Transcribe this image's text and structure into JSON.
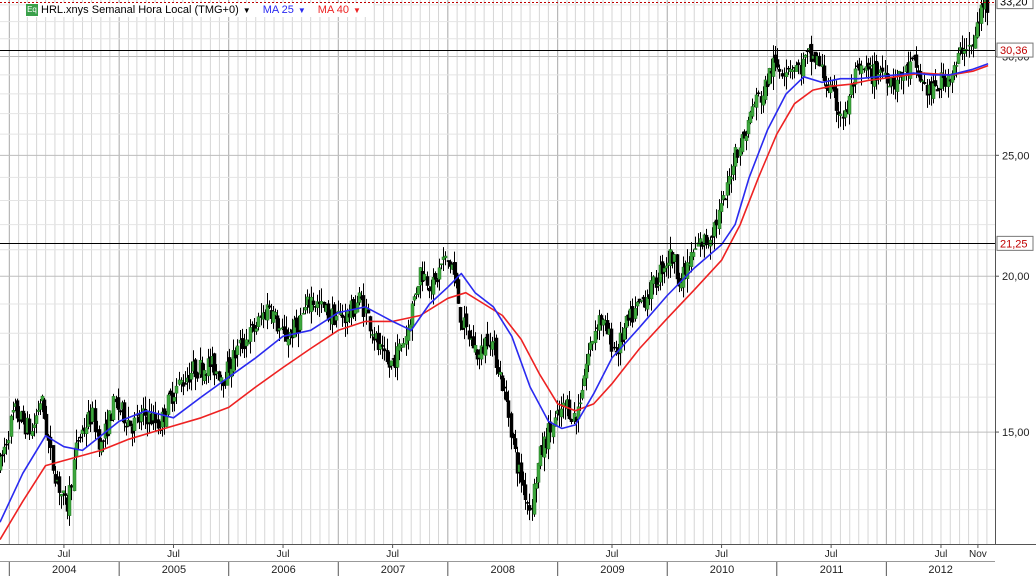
{
  "legend": {
    "icon": "Eq",
    "instrument": "HRL.xnys Semanal Hora Local (TMG+0)",
    "ma25": "MA 25",
    "ma40": "MA 40",
    "colors": {
      "ma25": "#2a2af0",
      "ma40": "#ee2222",
      "icon": "#3aa04a"
    }
  },
  "chart_data": {
    "type": "candlestick",
    "frequency": "weekly",
    "y_axis": {
      "ticks": [
        15.0,
        20.0,
        25.0,
        30.0
      ],
      "tick_labels": [
        "15,00",
        "20,00",
        "25,00",
        "30,00"
      ],
      "ylim": [
        12.2,
        33.3
      ],
      "position": "right"
    },
    "x_axis": {
      "xlim": [
        "2003-12-01",
        "2012-12-28"
      ],
      "years": [
        {
          "label": "2004",
          "date": "2004-01-01"
        },
        {
          "label": "2005",
          "date": "2005-01-01"
        },
        {
          "label": "2006",
          "date": "2006-01-01"
        },
        {
          "label": "2007",
          "date": "2007-01-01"
        },
        {
          "label": "2008",
          "date": "2008-01-01"
        },
        {
          "label": "2009",
          "date": "2009-01-01"
        },
        {
          "label": "2010",
          "date": "2010-01-01"
        },
        {
          "label": "2011",
          "date": "2011-01-01"
        },
        {
          "label": "2012",
          "date": "2012-01-01"
        }
      ],
      "months": [
        {
          "label": "Jul",
          "date": "2004-07-01"
        },
        {
          "label": "Jul",
          "date": "2005-07-01"
        },
        {
          "label": "Jul",
          "date": "2006-07-01"
        },
        {
          "label": "Jul",
          "date": "2007-07-01"
        },
        {
          "label": "Jul",
          "date": "2009-07-01"
        },
        {
          "label": "Jul",
          "date": "2010-07-01"
        },
        {
          "label": "Jul",
          "date": "2011-07-01"
        },
        {
          "label": "Jul",
          "date": "2012-07-01"
        },
        {
          "label": "Nov",
          "date": "2012-11-01"
        }
      ]
    },
    "price_path": [
      [
        "2003-12-01",
        14.1
      ],
      [
        "2004-01-15",
        15.6
      ],
      [
        "2004-03-15",
        15.0
      ],
      [
        "2004-04-15",
        16.0
      ],
      [
        "2004-05-20",
        14.2
      ],
      [
        "2004-06-20",
        13.4
      ],
      [
        "2004-07-10",
        13.0
      ],
      [
        "2004-08-15",
        14.8
      ],
      [
        "2004-10-01",
        15.5
      ],
      [
        "2004-11-01",
        14.6
      ],
      [
        "2004-12-15",
        15.8
      ],
      [
        "2005-02-15",
        15.2
      ],
      [
        "2005-04-01",
        15.5
      ],
      [
        "2005-05-15",
        15.2
      ],
      [
        "2005-07-01",
        16.2
      ],
      [
        "2005-09-01",
        16.8
      ],
      [
        "2005-11-01",
        17.0
      ],
      [
        "2005-12-15",
        16.6
      ],
      [
        "2006-02-01",
        17.5
      ],
      [
        "2006-04-01",
        18.2
      ],
      [
        "2006-05-15",
        19.0
      ],
      [
        "2006-07-01",
        17.8
      ],
      [
        "2006-08-15",
        18.2
      ],
      [
        "2006-10-01",
        19.2
      ],
      [
        "2006-12-01",
        18.6
      ],
      [
        "2007-02-01",
        18.6
      ],
      [
        "2007-03-15",
        19.2
      ],
      [
        "2007-04-15",
        18.4
      ],
      [
        "2007-05-15",
        17.5
      ],
      [
        "2007-06-15",
        16.9
      ],
      [
        "2007-07-15",
        17.3
      ],
      [
        "2007-08-15",
        18.0
      ],
      [
        "2007-10-01",
        20.2
      ],
      [
        "2007-11-15",
        19.6
      ],
      [
        "2007-12-15",
        20.6
      ],
      [
        "2008-01-15",
        20.4
      ],
      [
        "2008-02-15",
        18.4
      ],
      [
        "2008-03-15",
        17.8
      ],
      [
        "2008-04-15",
        17.2
      ],
      [
        "2008-05-15",
        18.0
      ],
      [
        "2008-06-15",
        17.0
      ],
      [
        "2008-07-15",
        15.8
      ],
      [
        "2008-08-15",
        14.2
      ],
      [
        "2008-10-01",
        13.0
      ],
      [
        "2008-11-01",
        14.3
      ],
      [
        "2008-12-01",
        15.0
      ],
      [
        "2009-01-01",
        15.4
      ],
      [
        "2009-02-01",
        15.8
      ],
      [
        "2009-03-01",
        15.3
      ],
      [
        "2009-04-01",
        16.8
      ],
      [
        "2009-05-15",
        18.6
      ],
      [
        "2009-06-15",
        18.0
      ],
      [
        "2009-07-15",
        17.4
      ],
      [
        "2009-08-15",
        18.2
      ],
      [
        "2009-10-01",
        19.0
      ],
      [
        "2009-11-15",
        19.6
      ],
      [
        "2009-12-15",
        20.4
      ],
      [
        "2010-01-15",
        20.8
      ],
      [
        "2010-02-15",
        19.8
      ],
      [
        "2010-03-15",
        20.5
      ],
      [
        "2010-04-15",
        21.2
      ],
      [
        "2010-05-15",
        21.4
      ],
      [
        "2010-06-15",
        22.2
      ],
      [
        "2010-07-15",
        23.2
      ],
      [
        "2010-08-15",
        25.2
      ],
      [
        "2010-09-15",
        25.9
      ],
      [
        "2010-10-15",
        27.5
      ],
      [
        "2010-11-15",
        28.0
      ],
      [
        "2010-12-15",
        29.5
      ],
      [
        "2011-01-15",
        29.4
      ],
      [
        "2011-02-15",
        29.6
      ],
      [
        "2011-03-15",
        29.3
      ],
      [
        "2011-04-15",
        30.0
      ],
      [
        "2011-05-15",
        29.8
      ],
      [
        "2011-06-15",
        28.5
      ],
      [
        "2011-07-15",
        27.5
      ],
      [
        "2011-08-15",
        26.8
      ],
      [
        "2011-09-15",
        28.8
      ],
      [
        "2011-10-15",
        29.2
      ],
      [
        "2011-11-15",
        29.0
      ],
      [
        "2011-12-15",
        29.3
      ],
      [
        "2012-02-01",
        28.6
      ],
      [
        "2012-04-01",
        29.6
      ],
      [
        "2012-05-01",
        28.5
      ],
      [
        "2012-06-01",
        28.0
      ],
      [
        "2012-07-15",
        28.9
      ],
      [
        "2012-08-15",
        29.2
      ],
      [
        "2012-09-15",
        30.8
      ],
      [
        "2012-10-15",
        30.4
      ],
      [
        "2012-11-01",
        32.0
      ],
      [
        "2012-11-20",
        33.0
      ],
      [
        "2012-12-05",
        33.1
      ]
    ],
    "ma25_path": [
      [
        "2003-12-01",
        12.7
      ],
      [
        "2004-02-15",
        13.9
      ],
      [
        "2004-05-01",
        14.9
      ],
      [
        "2004-07-01",
        14.6
      ],
      [
        "2004-09-01",
        14.5
      ],
      [
        "2004-11-01",
        14.9
      ],
      [
        "2005-01-01",
        15.3
      ],
      [
        "2005-04-01",
        15.6
      ],
      [
        "2005-07-01",
        15.4
      ],
      [
        "2005-10-01",
        16.0
      ],
      [
        "2006-01-01",
        16.6
      ],
      [
        "2006-04-01",
        17.2
      ],
      [
        "2006-07-01",
        17.9
      ],
      [
        "2006-10-01",
        18.1
      ],
      [
        "2007-01-01",
        18.7
      ],
      [
        "2007-04-01",
        18.9
      ],
      [
        "2007-07-01",
        18.4
      ],
      [
        "2007-09-01",
        18.1
      ],
      [
        "2007-11-01",
        19.0
      ],
      [
        "2008-01-01",
        19.6
      ],
      [
        "2008-02-15",
        20.1
      ],
      [
        "2008-04-01",
        19.4
      ],
      [
        "2008-06-01",
        18.9
      ],
      [
        "2008-08-01",
        17.9
      ],
      [
        "2008-10-01",
        16.3
      ],
      [
        "2008-12-01",
        15.3
      ],
      [
        "2009-01-15",
        15.1
      ],
      [
        "2009-03-01",
        15.2
      ],
      [
        "2009-05-01",
        16.1
      ],
      [
        "2009-07-01",
        17.2
      ],
      [
        "2009-10-01",
        18.2
      ],
      [
        "2010-01-01",
        19.3
      ],
      [
        "2010-04-01",
        20.3
      ],
      [
        "2010-07-01",
        21.2
      ],
      [
        "2010-08-15",
        22.0
      ],
      [
        "2010-10-01",
        24.0
      ],
      [
        "2010-12-01",
        26.2
      ],
      [
        "2011-02-01",
        28.0
      ],
      [
        "2011-04-01",
        28.9
      ],
      [
        "2011-06-01",
        28.6
      ],
      [
        "2011-08-01",
        28.8
      ],
      [
        "2011-10-01",
        28.8
      ],
      [
        "2011-12-01",
        28.9
      ],
      [
        "2012-02-01",
        29.0
      ],
      [
        "2012-04-01",
        29.1
      ],
      [
        "2012-06-01",
        29.0
      ],
      [
        "2012-08-01",
        29.0
      ],
      [
        "2012-10-15",
        29.3
      ],
      [
        "2012-12-05",
        29.6
      ]
    ],
    "ma40_path": [
      [
        "2003-12-01",
        12.3
      ],
      [
        "2004-02-15",
        13.2
      ],
      [
        "2004-05-01",
        14.1
      ],
      [
        "2004-08-01",
        14.3
      ],
      [
        "2004-11-01",
        14.5
      ],
      [
        "2005-02-01",
        14.8
      ],
      [
        "2005-06-01",
        15.1
      ],
      [
        "2005-10-01",
        15.4
      ],
      [
        "2006-01-01",
        15.7
      ],
      [
        "2006-04-01",
        16.3
      ],
      [
        "2006-07-01",
        16.9
      ],
      [
        "2006-10-01",
        17.5
      ],
      [
        "2007-01-01",
        18.1
      ],
      [
        "2007-04-01",
        18.4
      ],
      [
        "2007-07-01",
        18.4
      ],
      [
        "2007-10-01",
        18.6
      ],
      [
        "2008-01-01",
        19.2
      ],
      [
        "2008-03-01",
        19.4
      ],
      [
        "2008-05-01",
        19.0
      ],
      [
        "2008-07-01",
        18.6
      ],
      [
        "2008-09-01",
        17.8
      ],
      [
        "2008-11-01",
        16.7
      ],
      [
        "2009-01-01",
        15.8
      ],
      [
        "2009-03-01",
        15.6
      ],
      [
        "2009-05-01",
        15.8
      ],
      [
        "2009-07-01",
        16.4
      ],
      [
        "2009-10-01",
        17.5
      ],
      [
        "2010-01-01",
        18.5
      ],
      [
        "2010-04-01",
        19.5
      ],
      [
        "2010-07-01",
        20.6
      ],
      [
        "2010-09-01",
        22.0
      ],
      [
        "2010-11-01",
        24.0
      ],
      [
        "2011-01-01",
        26.0
      ],
      [
        "2011-03-01",
        27.5
      ],
      [
        "2011-05-01",
        28.2
      ],
      [
        "2011-07-01",
        28.4
      ],
      [
        "2011-09-01",
        28.5
      ],
      [
        "2011-11-01",
        28.7
      ],
      [
        "2012-02-01",
        28.9
      ],
      [
        "2012-05-01",
        29.1
      ],
      [
        "2012-08-01",
        29.0
      ],
      [
        "2012-10-15",
        29.2
      ],
      [
        "2012-12-05",
        29.5
      ]
    ],
    "reference_lines": [
      {
        "value": 30.36,
        "label": "30,36",
        "color": "#000000",
        "label_color": "#c00000"
      },
      {
        "value": 21.25,
        "label": "21,25",
        "color": "#000000",
        "label_color": "#c00000"
      },
      {
        "value": 33.2,
        "label": "33,20",
        "color": "#c00000",
        "label_color": "#000000",
        "style": "dotted"
      }
    ],
    "grid": true
  }
}
